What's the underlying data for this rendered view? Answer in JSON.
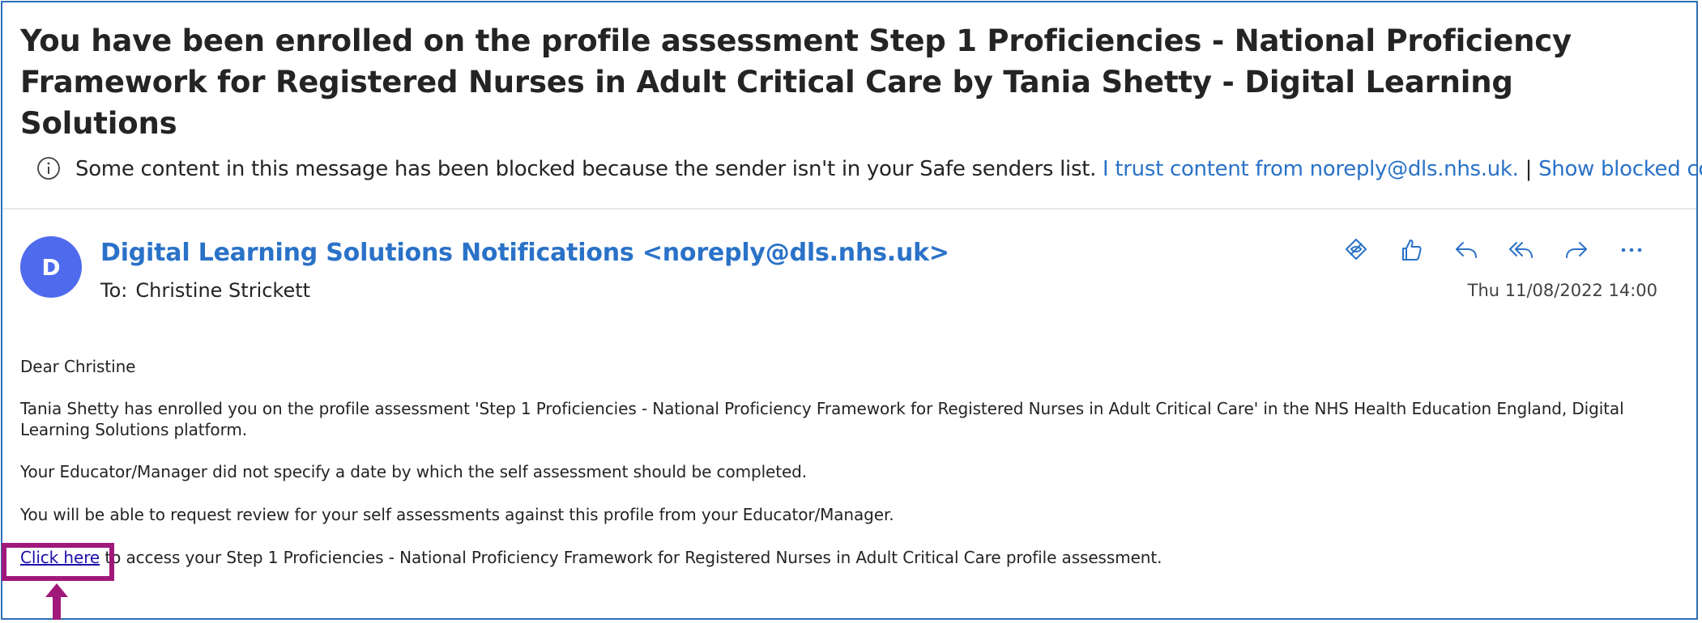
{
  "email": {
    "subject": "You have been enrolled on the profile assessment Step 1 Proficiencies - National Proficiency Framework for Registered Nurses in Adult Critical Care by Tania Shetty - Digital Learning Solutions",
    "blocked_notice": {
      "icon": "info-icon",
      "message": "Some content in this message has been blocked because the sender isn't in your Safe senders list.",
      "trust_link": "I trust content from noreply@dls.nhs.uk.",
      "separator": "|",
      "show_link": "Show blocked content"
    },
    "sender": {
      "avatar_initial": "D",
      "avatar_color": "#4f6bed",
      "display": "Digital Learning Solutions Notifications <noreply@dls.nhs.uk>"
    },
    "to_label": "To:",
    "to_name": "Christine Strickett",
    "date": "Thu 11/08/2022 14:00",
    "actions": [
      "immersive-reader-icon",
      "like-icon",
      "reply-icon",
      "reply-all-icon",
      "forward-icon",
      "more-icon"
    ],
    "body": {
      "greeting": "Dear Christine",
      "paragraph1": "Tania Shetty has enrolled you on the profile assessment 'Step 1 Proficiencies - National Proficiency Framework for Registered Nurses in Adult Critical Care' in the NHS Health Education England, Digital Learning Solutions platform.",
      "paragraph2": "Your Educator/Manager did not specify a date by which the self assessment should be completed.",
      "paragraph3": "You will be able to request review for your self assessments against this profile from your Educator/Manager.",
      "click_link": "Click here",
      "click_rest": " to access your Step 1 Proficiencies - National Proficiency Framework for Registered Nurses in Adult Critical Care profile assessment."
    }
  },
  "annotation": {
    "highlight_color": "#a0197a",
    "accent_color": "#2a72c8",
    "frame_color": "#2f6fb5"
  }
}
